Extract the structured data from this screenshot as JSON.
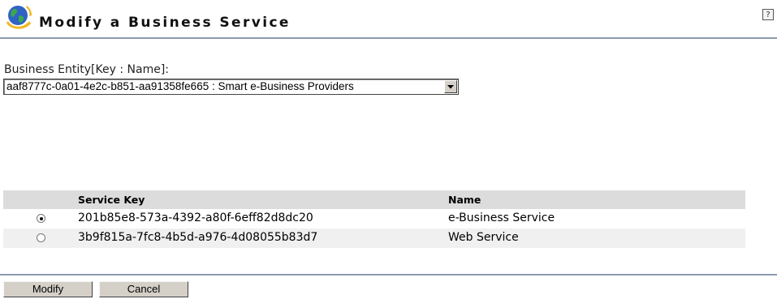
{
  "header": {
    "title": "Modify a Business Service",
    "logo_icon": "globe-icon",
    "help_label": "?"
  },
  "entity": {
    "label": "Business Entity[Key : Name]:",
    "selected": "aaf8777c-0a01-4e2c-b851-aa91358fe665 : Smart e-Business Providers"
  },
  "services": {
    "columns": {
      "select": "",
      "key": "Service Key",
      "name": "Name"
    },
    "rows": [
      {
        "key": "201b85e8-573a-4392-a80f-6eff82d8dc20",
        "name": "e-Business Service",
        "selected": true
      },
      {
        "key": "3b9f815a-7fc8-4b5d-a976-4d08055b83d7",
        "name": "Web Service",
        "selected": false
      }
    ]
  },
  "actions": {
    "modify_label": "Modify",
    "cancel_label": "Cancel"
  }
}
